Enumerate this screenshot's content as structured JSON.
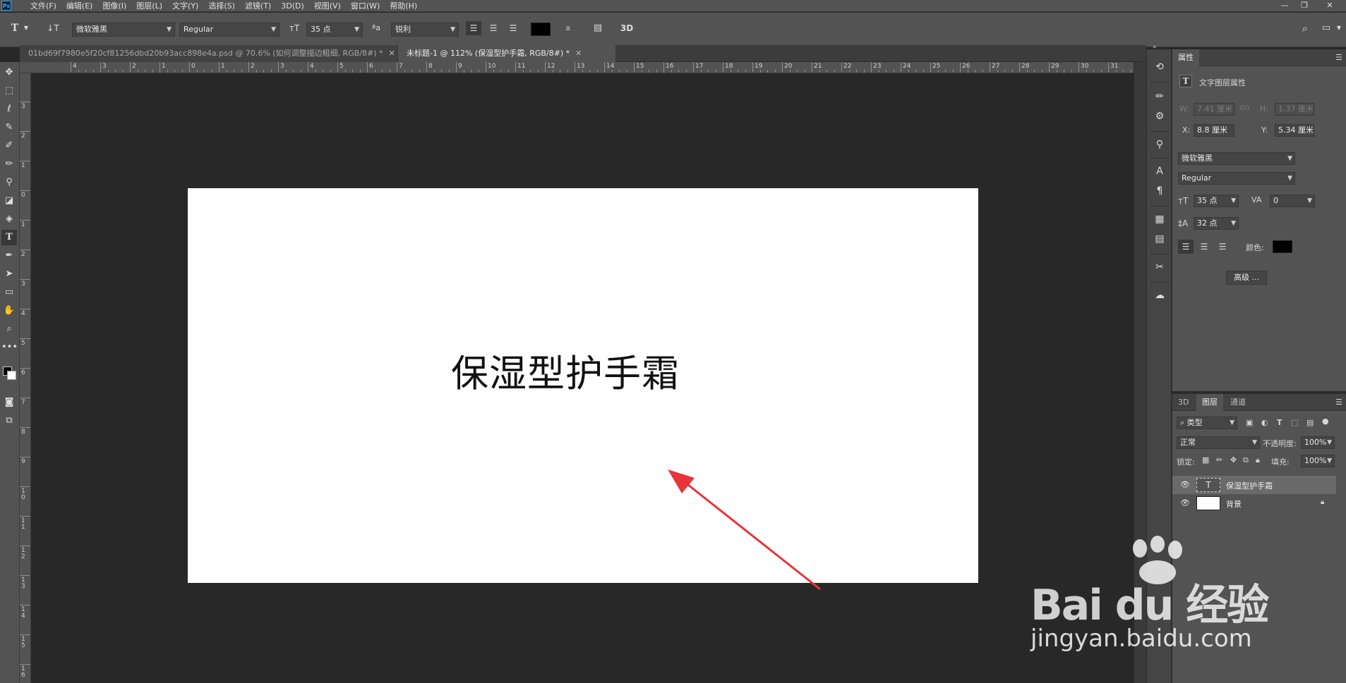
{
  "app": {
    "logo": "Ps"
  },
  "menu": [
    "文件(F)",
    "编辑(E)",
    "图像(I)",
    "图层(L)",
    "文字(Y)",
    "选择(S)",
    "滤镜(T)",
    "3D(D)",
    "视图(V)",
    "窗口(W)",
    "帮助(H)"
  ],
  "window_controls": {
    "minimize": "—",
    "restore": "❐",
    "close": "✕"
  },
  "options": {
    "font_family": "微软雅黑",
    "font_style": "Regular",
    "font_size": "35 点",
    "aa_icon": "ªa",
    "antialias": "锐利",
    "threed_label": "3D"
  },
  "tabs": [
    {
      "label": "01bd69f7980e5f20cf81256dbd20b93acc898e4a.psd @ 70.6% (如何调整描边粗细, RGB/8#) *",
      "active": false
    },
    {
      "label": "未标题-1 @ 112% (保湿型护手霜, RGB/8#) *",
      "active": true
    }
  ],
  "ruler": {
    "h_numbers": [
      "4",
      "3",
      "2",
      "1",
      "0",
      "1",
      "2",
      "3",
      "4",
      "5",
      "6",
      "7",
      "8",
      "9",
      "10",
      "11",
      "12",
      "13",
      "14",
      "15",
      "16",
      "17",
      "18",
      "19",
      "20",
      "21",
      "22",
      "23",
      "24",
      "25",
      "26",
      "27",
      "28",
      "29",
      "30",
      "31"
    ],
    "v_numbers": [
      "3",
      "2",
      "1",
      "0",
      "1",
      "2",
      "3",
      "4",
      "5",
      "6",
      "7",
      "8",
      "9",
      "10",
      "11",
      "12",
      "13",
      "14",
      "15",
      "16"
    ]
  },
  "canvas": {
    "text": "保湿型护手霜"
  },
  "properties": {
    "tab": "属性",
    "header": "文字图层属性",
    "w_label": "W:",
    "w_value": "7.41 厘米",
    "link": "GO",
    "h_label": "H:",
    "h_value": "1.37 厘米",
    "x_label": "X:",
    "x_value": "8.8 厘米",
    "y_label": "Y:",
    "y_value": "5.34 厘米",
    "font_family": "微软雅黑",
    "font_style": "Regular",
    "font_size": "35 点",
    "tracking": "0",
    "leading": "32 点",
    "color_label": "颜色:",
    "advanced": "高级 ..."
  },
  "layers": {
    "tabs": [
      "3D",
      "图层",
      "通道"
    ],
    "active_tab": "图层",
    "filter": "类型",
    "blend_mode": "正常",
    "opacity_label": "不透明度:",
    "opacity": "100%",
    "lock_label": "锁定:",
    "fill_label": "填充:",
    "fill": "100%",
    "items": [
      {
        "name": "保湿型护手霜",
        "kind": "text",
        "selected": true
      },
      {
        "name": "背景",
        "kind": "pixel",
        "selected": false,
        "locked": true
      }
    ]
  },
  "watermark": {
    "logo": "Bai du 经验",
    "url": "jingyan.baidu.com"
  },
  "colors": {
    "accent": "#31a8ff",
    "arrow": "#e8343a",
    "panel": "#535353",
    "pasteboard": "#282828"
  }
}
